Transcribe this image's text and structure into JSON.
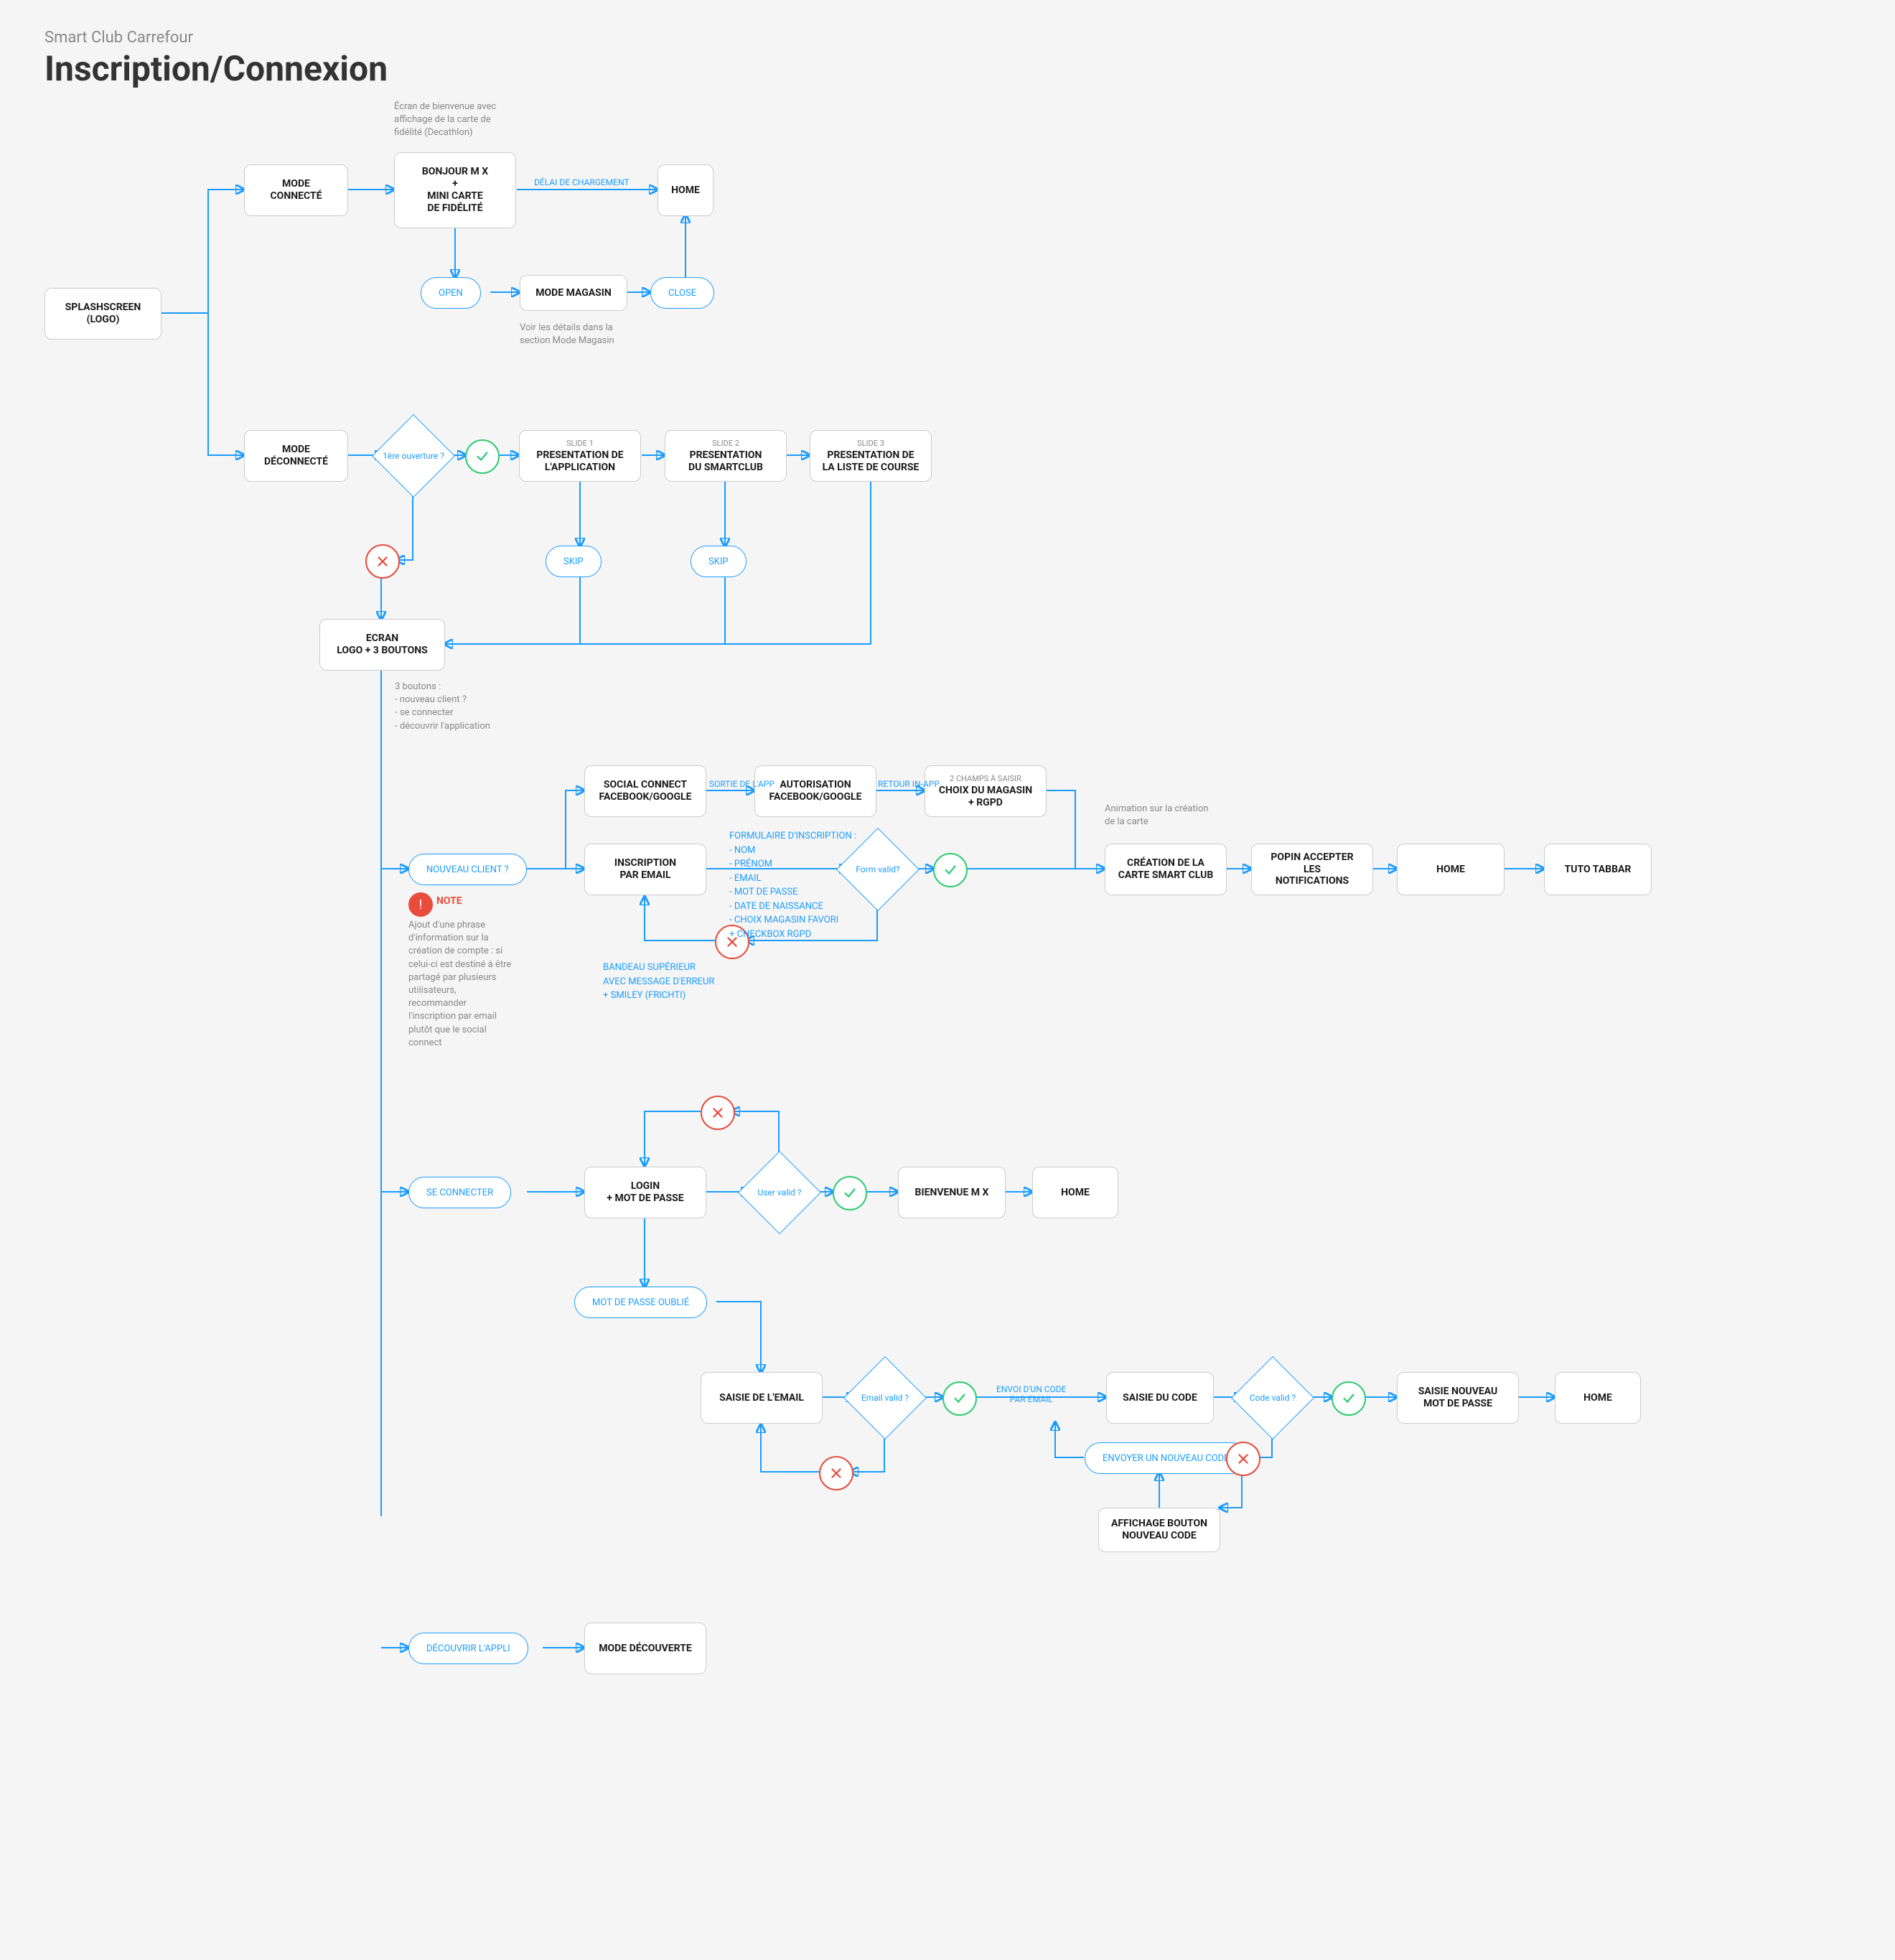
{
  "header": {
    "subtitle": "Smart Club Carrefour",
    "title": "Inscription/Connexion"
  },
  "nodes": {
    "splash": "SPLASHSCREEN\n(LOGO)",
    "modeConnecte": "MODE\nCONNECTÉ",
    "bonjour": "BONJOUR M X\n+\nMINI CARTE\nDE FIDÉLITÉ",
    "home1": "HOME",
    "modeMagasin": "MODE MAGASIN",
    "modeDeconnecte": "MODE\nDÉCONNECTÉ",
    "slide1_small": "SLIDE 1",
    "slide1": "PRESENTATION DE\nL'APPLICATION",
    "slide2_small": "SLIDE 2",
    "slide2": "PRESENTATION\nDU SMARTCLUB",
    "slide3_small": "SLIDE 3",
    "slide3": "PRESENTATION DE\nLA LISTE DE COURSE",
    "ecran3b": "ECRAN\nLOGO + 3 BOUTONS",
    "socialConnect": "SOCIAL CONNECT\nFACEBOOK/GOOGLE",
    "autorisation": "AUTORISATION\nFACEBOOK/GOOGLE",
    "choixMagasin_small": "2 CHAMPS À SAISIR",
    "choixMagasin": "CHOIX DU MAGASIN\n+ RGPD",
    "inscriptionEmail": "INSCRIPTION\nPAR EMAIL",
    "creationCarte": "CRÉATION DE LA\nCARTE SMART CLUB",
    "popinNotif": "POPIN ACCEPTER LES\nNOTIFICATIONS",
    "home2": "HOME",
    "tutoTabbar": "TUTO TABBAR",
    "loginMdp": "LOGIN\n+ MOT DE PASSE",
    "bienvenue": "BIENVENUE M X",
    "home3": "HOME",
    "saisieEmail": "SAISIE DE L'EMAIL",
    "saisieCode": "SAISIE DU CODE",
    "affichageBtn": "AFFICHAGE BOUTON\nNOUVEAU CODE",
    "saisieNouveauMdp": "SAISIE NOUVEAU\nMOT DE PASSE",
    "home4": "HOME",
    "modeDecouverte": "MODE DÉCOUVERTE"
  },
  "pills": {
    "open": "OPEN",
    "close": "CLOSE",
    "skip1": "SKIP",
    "skip2": "SKIP",
    "nouveauClient": "NOUVEAU CLIENT ?",
    "seConnecter": "SE CONNECTER",
    "mdpOublie": "MOT DE PASSE OUBLIÉ",
    "envoyerNouveauCode": "ENVOYER UN NOUVEAU CODE",
    "decouvrirAppli": "DÉCOUVRIR L'APPLI"
  },
  "diamonds": {
    "premiereOuverture": "1ère\nouverture\n?",
    "formValid": "Form valid?",
    "userValid": "User valid ?",
    "emailValid": "Email valid ?",
    "codeValid": "Code valid ?"
  },
  "labels": {
    "delaiChargement": "DÉLAI DE CHARGEMENT",
    "sortieApp": "SORTIE DE L'APP",
    "retourInApp": "RETOUR IN-APP",
    "envoiCode": "ENVOI D'UN CODE\nPAR EMAIL"
  },
  "annotations": {
    "ecranBienvenue": "Écran de bienvenue avec\naffichage de la carte de\nfidélité (Decathlon)",
    "voirDetails": "Voir les détails dans la\nsection Mode Magasin",
    "troisBoutons": "3 boutons :\n- nouveau client ?\n- se connecter\n- découvrir l'application",
    "animationCarte": "Animation sur la création\nde la carte",
    "noteTitle": "NOTE",
    "note": "Ajout d'une phrase\nd'information sur la\ncréation de compte : si\ncelui-ci est destiné à être\npartagé par plusieurs\nutilisateurs,\nrecommander\nl'inscription par email\nplutôt que le social\nconnect",
    "formulaire": "FORMULAIRE D'INSCRIPTION :\n- NOM\n- PRÉNOM\n- EMAIL\n- MOT DE PASSE\n- DATE DE NAISSANCE\n- CHOIX MAGASIN FAVORI\n+ CHECKBOX RGPD",
    "bandeau": "BANDEAU SUPÉRIEUR\nAVEC MESSAGE D'ERREUR\n+ SMILEY (FRICHTI)"
  }
}
